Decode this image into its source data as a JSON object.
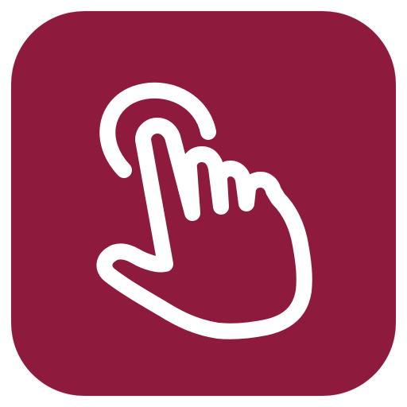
{
  "app_icon": {
    "glyph": "tap-gesture-icon",
    "background_color": "#8E1B3E",
    "glyph_color": "#FFFFFF"
  }
}
